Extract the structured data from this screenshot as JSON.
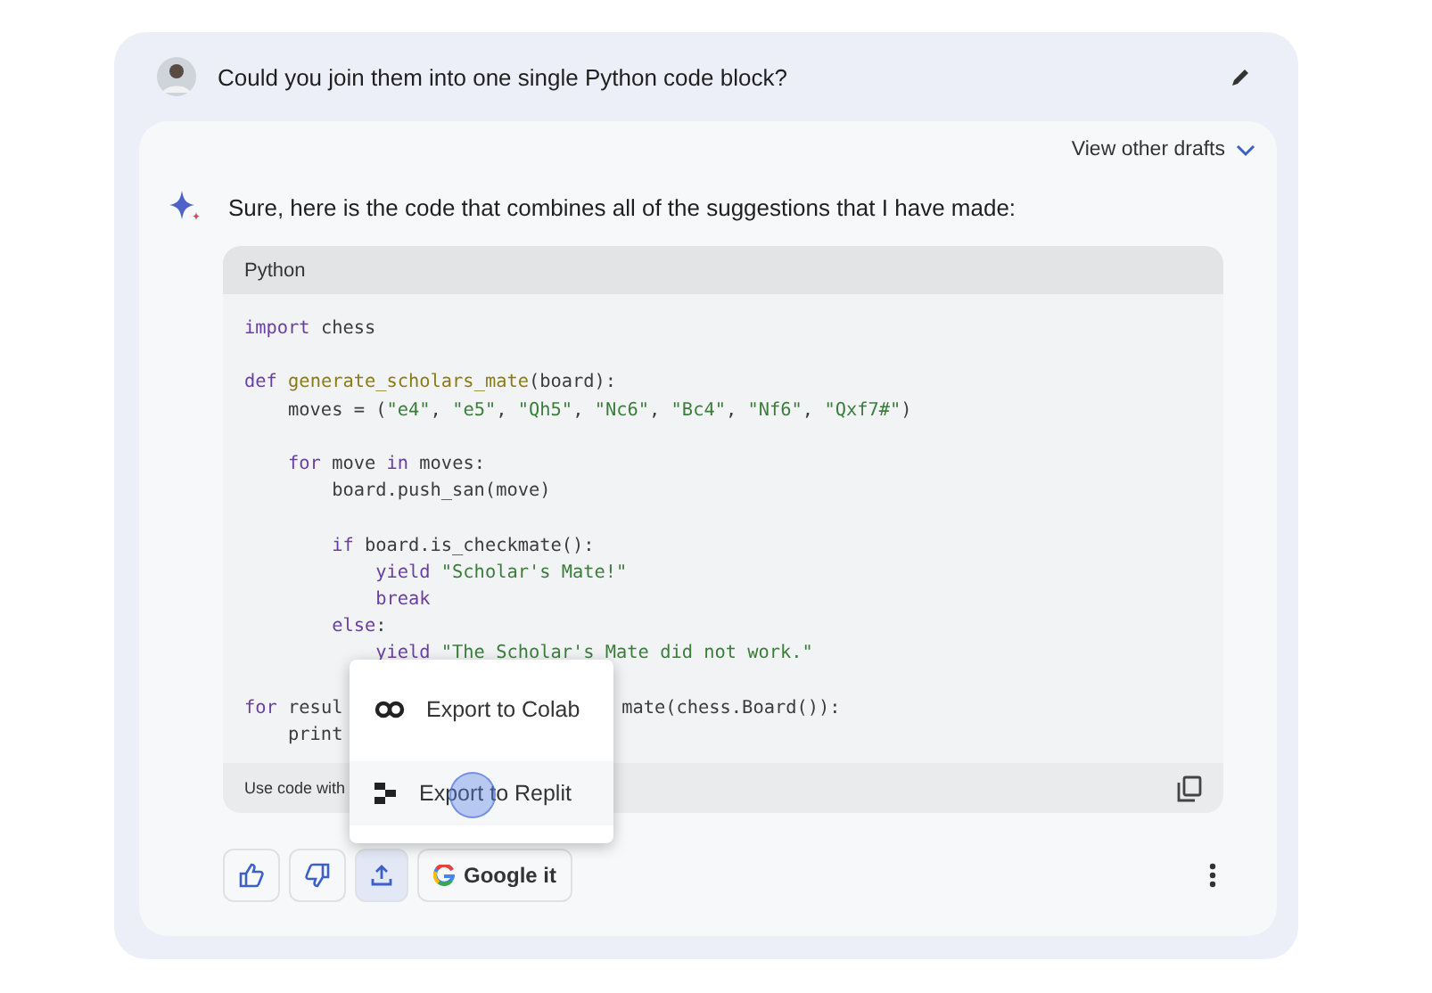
{
  "prompt": {
    "text": "Could you join them into one single Python code block?"
  },
  "drafts": {
    "label": "View other drafts",
    "expanded": false
  },
  "response": {
    "intro": "Sure, here is the code that combines all of the suggestions that I have made:"
  },
  "code": {
    "language": "Python",
    "blocks": [
      [
        {
          "segments": [
            {
              "kind": "kw",
              "text": "import"
            },
            {
              "kind": "plain",
              "text": " chess"
            }
          ]
        }
      ],
      [
        {
          "segments": [
            {
              "kind": "kw",
              "text": "def "
            },
            {
              "kind": "fn",
              "text": "generate_scholars_mate"
            },
            {
              "kind": "plain",
              "text": "(board):"
            }
          ]
        },
        {
          "segments": [
            {
              "kind": "plain",
              "text": "    moves = ("
            },
            {
              "kind": "str",
              "text": "\"e4\""
            },
            {
              "kind": "plain",
              "text": ", "
            },
            {
              "kind": "str",
              "text": "\"e5\""
            },
            {
              "kind": "plain",
              "text": ", "
            },
            {
              "kind": "str",
              "text": "\"Qh5\""
            },
            {
              "kind": "plain",
              "text": ", "
            },
            {
              "kind": "str",
              "text": "\"Nc6\""
            },
            {
              "kind": "plain",
              "text": ", "
            },
            {
              "kind": "str",
              "text": "\"Bc4\""
            },
            {
              "kind": "plain",
              "text": ", "
            },
            {
              "kind": "str",
              "text": "\"Nf6\""
            },
            {
              "kind": "plain",
              "text": ", "
            },
            {
              "kind": "str",
              "text": "\"Qxf7#\""
            },
            {
              "kind": "plain",
              "text": ")"
            }
          ]
        }
      ],
      [
        {
          "segments": [
            {
              "kind": "kw",
              "text": "    for"
            },
            {
              "kind": "plain",
              "text": " move "
            },
            {
              "kind": "kw",
              "text": "in"
            },
            {
              "kind": "plain",
              "text": " moves:"
            }
          ]
        },
        {
          "segments": [
            {
              "kind": "plain",
              "text": "        board.push_san(move)"
            }
          ]
        }
      ],
      [
        {
          "segments": [
            {
              "kind": "kw",
              "text": "        if"
            },
            {
              "kind": "plain",
              "text": " board.is_checkmate():"
            }
          ]
        },
        {
          "segments": [
            {
              "kind": "kw",
              "text": "            yield "
            },
            {
              "kind": "str",
              "text": "\"Scholar's Mate!\""
            }
          ]
        },
        {
          "segments": [
            {
              "kind": "kw",
              "text": "            break"
            }
          ]
        },
        {
          "segments": [
            {
              "kind": "kw",
              "text": "        else"
            },
            {
              "kind": "plain",
              "text": ":"
            }
          ]
        },
        {
          "segments": [
            {
              "kind": "kw",
              "text": "            yield "
            },
            {
              "kind": "str",
              "text": "\"The Scholar's Mate did not work.\""
            }
          ]
        }
      ],
      [
        {
          "segments": [
            {
              "kind": "kw",
              "text": "for"
            },
            {
              "kind": "plain",
              "text": " resul"
            }
          ],
          "after_menu": [
            {
              "kind": "plain",
              "text": "mate(chess.Board()):"
            }
          ]
        },
        {
          "segments": [
            {
              "kind": "plain",
              "text": "    print"
            }
          ]
        }
      ]
    ],
    "footer": "Use code with"
  },
  "export_menu": {
    "items": [
      {
        "kind": "colab",
        "label": "Export to Colab",
        "selected": false
      },
      {
        "kind": "replit",
        "label": "Export to Replit",
        "selected": true
      }
    ]
  },
  "actions": [
    {
      "kind": "thumbs_up",
      "selected": false
    },
    {
      "kind": "thumbs_down",
      "selected": false
    },
    {
      "kind": "share",
      "selected": true
    },
    {
      "kind": "google",
      "label": "Google it",
      "selected": false
    }
  ]
}
